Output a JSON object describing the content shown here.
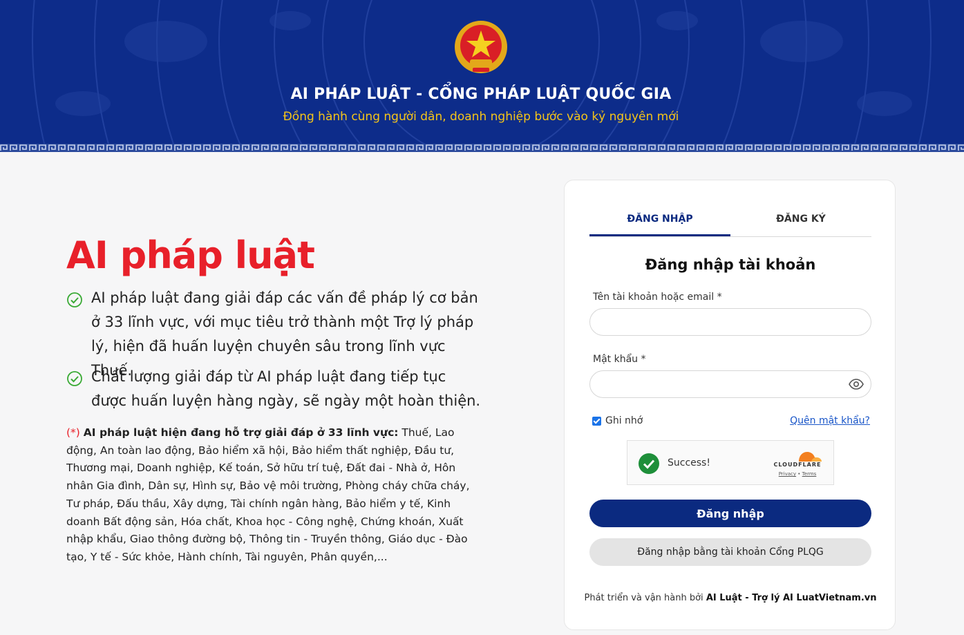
{
  "header": {
    "title": "AI PHÁP LUẬT - CỔNG PHÁP LUẬT QUỐC GIA",
    "subtitle": "Đồng hành cùng người dân, doanh nghiệp bước vào kỷ nguyên mới"
  },
  "hero": {
    "title": "AI pháp luật",
    "features": [
      "AI pháp luật đang giải đáp các vấn đề pháp lý cơ bản ở 33 lĩnh vực, với mục tiêu trở thành một Trợ lý pháp lý, hiện đã huấn luyện chuyên sâu trong lĩnh vực Thuế.",
      "Chất lượng giải đáp từ AI pháp luật đang tiếp tục được huấn luyện hàng ngày, sẽ ngày một hoàn thiện."
    ],
    "note_star": "(*)",
    "note_bold": "AI pháp luật hiện đang hỗ trợ giải đáp ở 33 lĩnh vực:",
    "note_text": "Thuế, Lao động, An toàn lao động, Bảo hiểm xã hội, Bảo hiểm thất nghiệp, Đầu tư, Thương mại, Doanh nghiệp, Kế toán, Sở hữu trí tuệ, Đất đai - Nhà ở, Hôn nhân Gia đình, Dân sự, Hình sự, Bảo vệ môi trường, Phòng cháy chữa cháy, Tư pháp, Đấu thầu, Xây dựng, Tài chính ngân hàng, Bảo hiểm y tế, Kinh doanh Bất động sản, Hóa chất, Khoa học - Công nghệ, Chứng khoán, Xuất nhập khẩu, Giao thông đường bộ, Thông tin - Truyền thông, Giáo dục - Đào tạo, Y tế - Sức khỏe, Hành chính, Tài nguyên, Phân quyền,..."
  },
  "auth": {
    "tabs": [
      "ĐĂNG NHẬP",
      "ĐĂNG KÝ"
    ],
    "active_tab": 0,
    "title": "Đăng nhập tài khoản",
    "username_label": "Tên tài khoản hoặc email *",
    "username_value": "",
    "password_label": "Mật khẩu *",
    "password_value": "",
    "remember_label": "Ghi nhớ",
    "remember_checked": true,
    "forgot_label": "Quên mật khẩu?",
    "captcha": {
      "status": "Success!",
      "brand": "CLOUDFLARE",
      "privacy": "Privacy",
      "separator": "•",
      "terms": "Terms"
    },
    "submit_label": "Đăng nhập",
    "alt_login_label": "Đăng nhập bằng tài khoản Cổng PLQG",
    "footer_prefix": "Phát triển và vận hành bởi",
    "footer_brand": "AI Luật - Trợ lý AI LuatVietnam.vn"
  },
  "colors": {
    "header_bg": "#0d2c8a",
    "hero_red": "#e8202a",
    "primary": "#0b2a80",
    "subtitle_yellow": "#f5c518",
    "check_green": "#3aaa35"
  },
  "icons": {
    "emblem": "national-emblem-icon",
    "check": "check-circle-icon",
    "eye": "eye-icon",
    "cloud": "cloudflare-cloud-icon",
    "success": "success-check-icon"
  }
}
